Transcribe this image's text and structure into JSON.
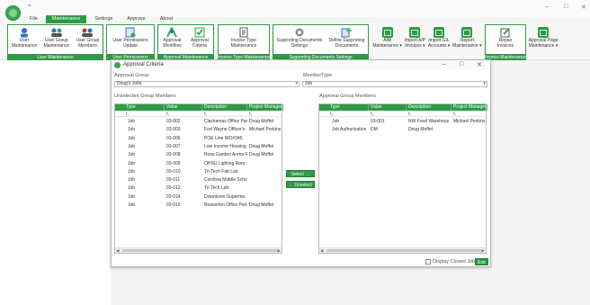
{
  "titlebar": {
    "qa_symbol": "=",
    "minimize": "–",
    "maximize": "□",
    "close": "✕"
  },
  "menu": {
    "tabs": [
      {
        "label": "File",
        "active": false
      },
      {
        "label": "Maintenance",
        "active": true
      },
      {
        "label": "Settings",
        "active": false
      },
      {
        "label": "Approve",
        "active": false
      },
      {
        "label": "About",
        "active": false
      }
    ]
  },
  "ribbon": {
    "groups": [
      {
        "label": "User Maintenance",
        "buttons": [
          "User\nMaintenance",
          "User Group\nMaintenance",
          "User Group\nMembers"
        ]
      },
      {
        "label": "User Permissions",
        "buttons": [
          "User Permissions\nUpdate"
        ]
      },
      {
        "label": "Approval Maintenance",
        "buttons": [
          "Approval\nWorkflow",
          "Approval\nCriteria"
        ]
      },
      {
        "label": "Invoice Type Maintenance",
        "buttons": [
          "Invoice Type\nMaintenance"
        ]
      },
      {
        "label": "Supporting Documents Settings",
        "buttons": [
          "Supporting Documents\nSettings",
          "Define Supporting\nDocuments"
        ]
      },
      {
        "label": "",
        "buttons": [
          "AIM\nMaintenance ▾",
          "Import A/P\nInvoices ▾",
          "Import G/L\nAccounts ▾",
          "Report\nMaintenance ▾"
        ]
      },
      {
        "label": "Invoice Maintenance",
        "buttons": [
          "Repair\nInvoices"
        ]
      },
      {
        "label": "",
        "buttons": [
          "Approval Page\nMaintenance ▾"
        ]
      }
    ]
  },
  "dialog": {
    "title": "Approval Criteria",
    "approval_group_label": "Approval Group",
    "approval_group_value": "Doug's Jobs",
    "member_type_label": "MemberType",
    "member_type_value": "Job",
    "unselected_label": "Unselected Group Members",
    "approval_label": "Approval Group Members",
    "columns": [
      "Type",
      "Value",
      "Description",
      "Project Manager"
    ],
    "filter_glyph": "fₓ",
    "unselected_rows": [
      [
        "Job",
        "03-002",
        "Clackamas Office Par",
        "Doug Moffet"
      ],
      [
        "Job",
        "03-003",
        "Fort Wayne Officer's",
        "Michael Perkins"
      ],
      [
        "Job",
        "03-006",
        "POE Line WO#345",
        ""
      ],
      [
        "Job",
        "03-007",
        "Low Income Housing",
        "Doug Moffet"
      ],
      [
        "Job",
        "03-008",
        "Rose Garden Arena R",
        "Doug Moffet"
      ],
      [
        "Job",
        "03-009",
        "OHSU Lighting Renr",
        ""
      ],
      [
        "Job",
        "03-010",
        "Tri-Tech Fab Lab",
        ""
      ],
      [
        "Job",
        "03-011",
        "Cordova Middle Scho",
        ""
      ],
      [
        "Job",
        "03-012",
        "Tri Tech Lab",
        ""
      ],
      [
        "Job",
        "03-014",
        "Downtown Superma",
        ""
      ],
      [
        "Job",
        "03-015",
        "Beaverton Office Parl",
        "Doug Moffet"
      ]
    ],
    "approval_rows": [
      [
        "Job",
        "03-001",
        "NW Food Warehous",
        "Michael Perkins"
      ],
      [
        "Job Authorization",
        "DM",
        "Doug Moffet",
        ""
      ]
    ],
    "select_button": "Select →",
    "unselect_button": "← Unselect",
    "display_closed_jobs": "Display Closed Jobs",
    "exit_button": "Exit",
    "min": "–",
    "max": "□",
    "close": "✕"
  }
}
